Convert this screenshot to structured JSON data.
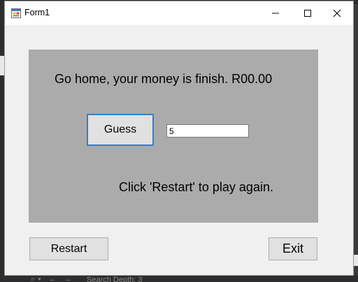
{
  "window": {
    "title": "Form1",
    "icon": "winforms-app-icon",
    "caption_buttons": [
      "minimize-icon",
      "maximize-icon",
      "close-icon"
    ]
  },
  "panel": {
    "message": "Go home, your money is finish. R00.00",
    "guess_button_label": "Guess",
    "guess_input_value": "5",
    "hint": "Click 'Restart' to play again."
  },
  "buttons": {
    "restart_label": "Restart",
    "exit_label": "Exit"
  },
  "background": {
    "status_hint": "Search Depth: 3"
  },
  "colors": {
    "panel": "#ababab",
    "form": "#f0f0f0",
    "focus_border": "#2f7fce"
  }
}
